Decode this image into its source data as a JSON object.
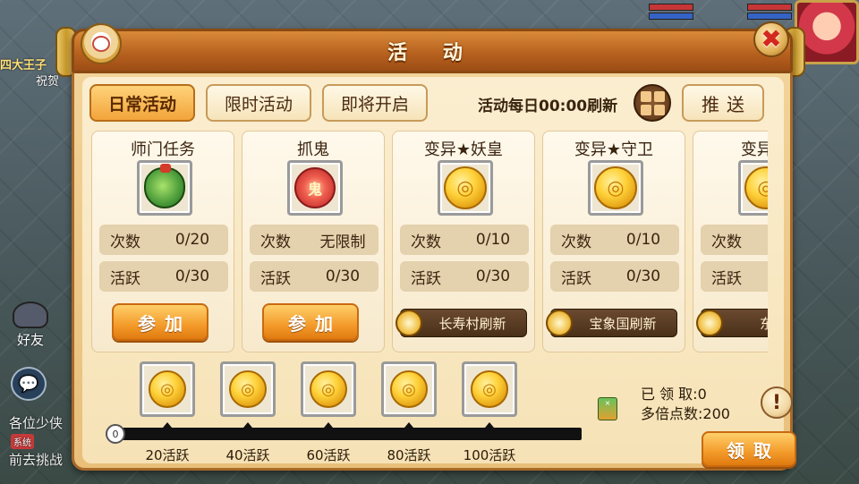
{
  "window": {
    "title": "活 动"
  },
  "tabs": [
    {
      "label": "日常活动",
      "active": true
    },
    {
      "label": "限时活动",
      "active": false
    },
    {
      "label": "即将开启",
      "active": false
    }
  ],
  "refresh_note": "活动每日00:00刷新",
  "push_label": "推送",
  "cards": [
    {
      "title": "师门任务",
      "icon": "green-bag-icon",
      "times_label": "次数",
      "times_value": "0/20",
      "active_label": "活跃",
      "active_value": "0/30",
      "action": {
        "type": "join",
        "label": "参加"
      }
    },
    {
      "title": "抓鬼",
      "icon": "red-ghost-charm-icon",
      "times_label": "次数",
      "times_value": "无限制",
      "active_label": "活跃",
      "active_value": "0/30",
      "action": {
        "type": "join",
        "label": "参加"
      }
    },
    {
      "title": "变异★妖皇",
      "icon": "gold-coin-icon",
      "times_label": "次数",
      "times_value": "0/10",
      "active_label": "活跃",
      "active_value": "0/30",
      "action": {
        "type": "refresh",
        "label": "长寿村刷新"
      }
    },
    {
      "title": "变异★守卫",
      "icon": "gold-coin-icon",
      "times_label": "次数",
      "times_value": "0/10",
      "active_label": "活跃",
      "active_value": "0/30",
      "action": {
        "type": "refresh",
        "label": "宝象国刷新"
      }
    },
    {
      "title": "变异★",
      "icon": "gold-coin-icon",
      "times_label": "次数",
      "times_value": "",
      "active_label": "活跃",
      "active_value": "",
      "action": {
        "type": "refresh",
        "label": "东海"
      }
    }
  ],
  "progress": {
    "current_value": 0,
    "start_label": "0",
    "milestones": [
      {
        "label": "20活跃",
        "icon": "gold-coin-icon"
      },
      {
        "label": "40活跃",
        "icon": "gold-coin-icon"
      },
      {
        "label": "60活跃",
        "icon": "gold-coin-icon"
      },
      {
        "label": "80活跃",
        "icon": "gold-coin-icon"
      },
      {
        "label": "100活跃",
        "icon": "gold-coin-icon"
      }
    ]
  },
  "claim_panel": {
    "claimed_label": "已 领 取:",
    "claimed_value": "0",
    "multiplier_label": "多倍点数:",
    "multiplier_value": "200",
    "help_label": "!",
    "claim_label": "领取"
  },
  "background": {
    "friend_label": "好友",
    "message_line1": "各位少侠",
    "message_tag": "系统",
    "message_line2": "前去挑战",
    "topleft_text1": "四大王子",
    "topleft_text2": "祝贺"
  }
}
